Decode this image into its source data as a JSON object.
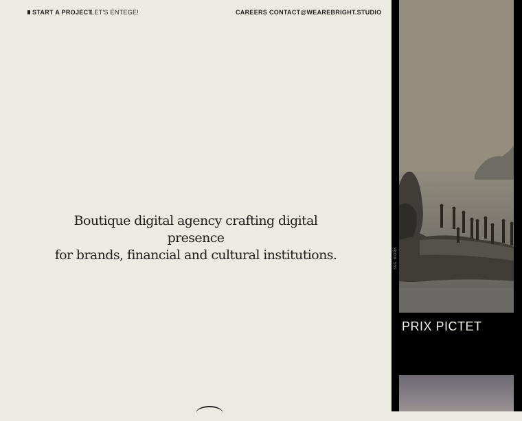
{
  "nav": {
    "start_project": "START A PROJECT",
    "lets_entege": "LET'S ENTEGE!",
    "careers": "CAREERS",
    "contact": "CONTACT@WEAREBRIGHT.STUDIO"
  },
  "hero": {
    "line1": "Boutique digital agency crafting digital presence",
    "line2": "for brands, financial and cultural institutions."
  },
  "side": {
    "see_work": "SEE WORK",
    "project_title": "PRIX PICTET"
  },
  "icons": {
    "start_project_marker": "square-icon",
    "scroll": "scroll-arc-icon"
  }
}
